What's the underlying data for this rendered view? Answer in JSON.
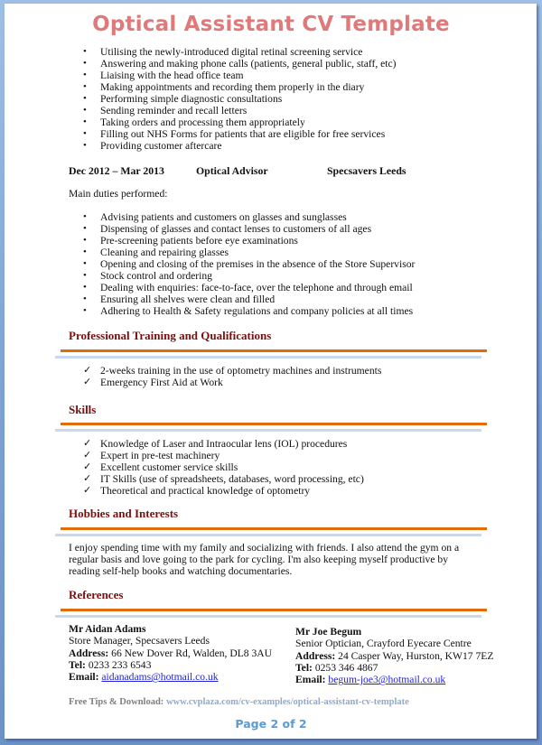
{
  "document": {
    "title": "Optical Assistant CV Template",
    "prev_job_duties": [
      "Utilising the newly-introduced digital retinal screening service",
      "Answering and making phone calls (patients, general public, staff, etc)",
      "Liaising with the head office team",
      "Making appointments and recording them properly in the diary",
      "Performing simple diagnostic consultations",
      "Sending reminder and recall letters",
      "Taking orders and processing them appropriately",
      "Filling out NHS Forms for patients that are eligible for free services",
      "Providing customer aftercare"
    ],
    "job": {
      "dates": "Dec 2012 – Mar 2013",
      "position": "Optical Advisor",
      "employer": "Specsavers Leeds",
      "intro": "Main duties performed:",
      "duties": [
        "Advising patients and customers on glasses and sunglasses",
        "Dispensing of glasses and contact lenses to customers of all ages",
        "Pre-screening patients before eye examinations",
        "Cleaning and repairing glasses",
        "Opening and closing of the premises in the absence of the Store Supervisor",
        "Stock control and ordering",
        "Dealing with enquiries: face-to-face, over the telephone and through email",
        "Ensuring all shelves were clean and filled",
        "Adhering to Health & Safety regulations and company policies at all times"
      ]
    },
    "training": {
      "heading": "Professional Training and Qualifications",
      "items": [
        "2-weeks training in the use of optometry machines and instruments",
        "Emergency First Aid at Work"
      ]
    },
    "skills": {
      "heading": "Skills",
      "items": [
        "Knowledge of Laser and Intraocular lens (IOL) procedures",
        "Expert in pre-test machinery",
        "Excellent customer service skills",
        "IT Skills (use of spreadsheets, databases, word processing, etc)",
        "Theoretical and practical knowledge of optometry"
      ]
    },
    "hobbies": {
      "heading": "Hobbies and Interests",
      "lines": [
        "I enjoy spending time with my family and socializing with friends. I also attend the gym on a",
        "regular basis and love going to the park for cycling. I'm also keeping myself productive by",
        "reading self-help books and watching documentaries."
      ]
    },
    "references": {
      "heading": "References",
      "address_label": "Address:",
      "tel_label": "Tel:",
      "email_label": "Email:",
      "people": [
        {
          "name": "Mr Aidan Adams",
          "role": "Store Manager, Specsavers Leeds",
          "address": "66 New Dover Rd, Walden, DL8 3AU",
          "tel": "0233 233 6543",
          "email": "aidanadams@hotmail.co.uk"
        },
        {
          "name": "Mr Joe Begum",
          "role": "Senior Optician, Crayford Eyecare Centre",
          "address": "24 Casper Way, Hurston, KW17 7EZ",
          "tel": "0253 346 4867",
          "email": "begum-joe3@hotmail.co.uk"
        }
      ]
    },
    "footer": {
      "tips_label": "Free Tips & Download:",
      "url": "www.cvplaza.com/cv-examples/optical-assistant-cv-template",
      "page": "Page 2 of 2"
    },
    "colors": {
      "title": "#e07a7a",
      "section_heading": "#7a0f0f",
      "rule_orange": "#e36c0a",
      "rule_blue": "#c6d9f1",
      "page_number": "#5b9bd5"
    },
    "icons": {
      "bullet": "•",
      "check": "✓"
    }
  }
}
